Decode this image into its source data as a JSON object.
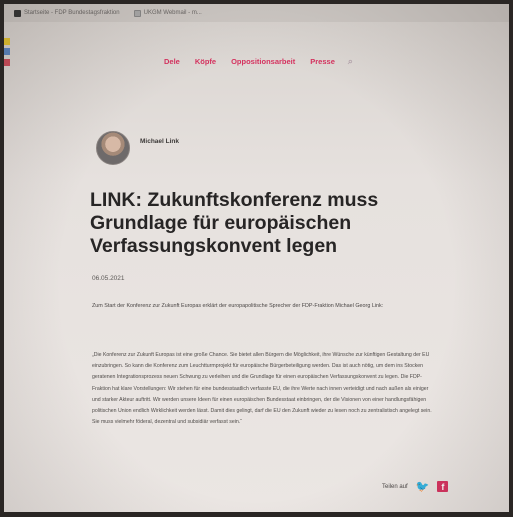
{
  "bookmarks": [
    {
      "label": "Startseite - FDP Bundestagsfraktion"
    },
    {
      "label": "UKGM Webmail - m..."
    }
  ],
  "nav": {
    "items": [
      "Dele",
      "Köpfe",
      "Oppositionsarbeit",
      "Presse"
    ],
    "search_icon": "search-icon"
  },
  "author": {
    "name": "Michael Link"
  },
  "article": {
    "title": "LINK: Zukunftskonferenz muss Grundlage für europäischen Verfassungskonvent legen",
    "date": "06.05.2021",
    "lead": "Zum Start der Konferenz zur Zukunft Europas erklärt der europapolitische Sprecher der FDP-Fraktion Michael Georg Link:",
    "body": "„Die Konferenz zur Zukunft Europas ist eine große Chance. Sie bietet allen Bürgern die Möglichkeit, ihre Wünsche zur künftigen Gestaltung der EU einzubringen. So kann die Konferenz zum Leuchtturmprojekt für europäische Bürgerbeteiligung werden. Das ist auch nötig, um dem ins Stocken geratenen Integrationsprozess neuen Schwung zu verleihen und die Grundlage für einen europäischen Verfassungskonvent zu legen. Die FDP-Fraktion hat klare Vorstellungen: Wir stehen für eine bundesstaatlich verfasste EU, die ihre Werte nach innen verteidigt und nach außen als einiger und starker Akteur auftritt. Wir werden unsere Ideen für einen europäischen Bundesstaat einbringen, der die Visionen von einer handlungsfähigen politischen Union endlich Wirklichkeit werden lässt. Damit dies gelingt, darf die EU den Zukunft wieder zu lesen noch zu zentralistisch angelegt sein. Sie muss vielmehr föderal, dezentral und subsidiär verfasst sein.“"
  },
  "share": {
    "label": "Teilen auf",
    "twitter_glyph": "🐦",
    "facebook_glyph": "f"
  },
  "colors": {
    "accent": "#d6325f",
    "text": "#272525"
  }
}
